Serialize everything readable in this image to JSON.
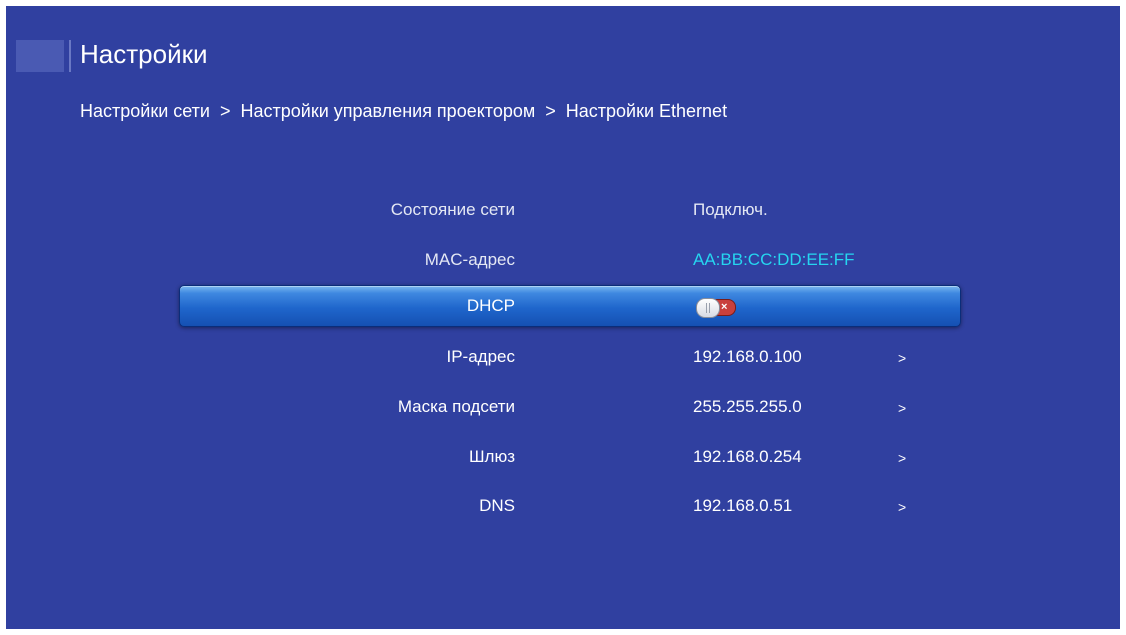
{
  "header": {
    "title": "Настройки",
    "icon": "settings-icon"
  },
  "breadcrumb": {
    "items": [
      "Настройки сети",
      "Настройки управления проектором",
      "Настройки Ethernet"
    ],
    "separator": ">"
  },
  "settings": [
    {
      "label": "Состояние сети",
      "value": "Подключ."
    },
    {
      "label": "MAC-адрес",
      "value": "AA:BB:CC:DD:EE:FF"
    },
    {
      "label": "DHCP",
      "toggle": "off"
    },
    {
      "label": "IP-адрес",
      "value": "192.168.0.100",
      "arrow": ">"
    },
    {
      "label": "Маска подсети",
      "value": "255.255.255.0",
      "arrow": ">"
    },
    {
      "label": "Шлюз",
      "value": "192.168.0.254",
      "arrow": ">"
    },
    {
      "label": "DNS",
      "value": "192.168.0.51",
      "arrow": ">"
    }
  ],
  "colors": {
    "background": "#3040a0",
    "highlight": "#1f66cc",
    "mac_value": "#25d6f0",
    "toggle_off": "#c9403c"
  }
}
